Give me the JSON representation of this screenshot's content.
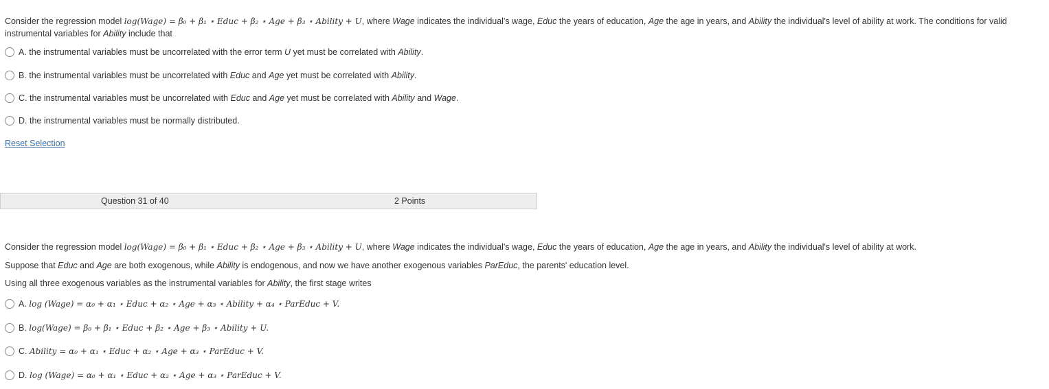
{
  "q30": {
    "stem_prefix": "Consider the regression model ",
    "model": "log(Wage) = β₀ + β₁ ⋆ Educ + β₂ ⋆ Age + β₃ ⋆ Ability + U",
    "stem_mid": ", where ",
    "var_wage": "Wage",
    "stem_wage_desc": " indicates the individual's wage, ",
    "var_educ": "Educ",
    "stem_educ_desc": " the years of education, ",
    "var_age": "Age",
    "stem_age_desc": " the age in years, and ",
    "var_ability": "Ability",
    "stem_ability_desc": " the individual's level of ability at work. The conditions for valid",
    "stem_line2_prefix": "instrumental variables for ",
    "stem_line2_var": "Ability",
    "stem_line2_suffix": " include that",
    "options": {
      "A": {
        "prefix": "A. the instrumental variables must be uncorrelated with the error term ",
        "v1": "U",
        "mid": " yet must be correlated with ",
        "v2": "Ability",
        "suffix": "."
      },
      "B": {
        "prefix": "B. the instrumental variables must be uncorrelated with ",
        "v1": "Educ",
        "and": " and ",
        "v2": "Age",
        "mid": " yet must be correlated with ",
        "v3": "Ability",
        "suffix": "."
      },
      "C": {
        "prefix": "C. the instrumental variables must be uncorrelated with ",
        "v1": "Educ",
        "and": " and ",
        "v2": "Age",
        "mid": " yet must be correlated with ",
        "v3": "Ability",
        "and2": " and ",
        "v4": "Wage",
        "suffix": "."
      },
      "D": {
        "text": "D. the instrumental variables must be normally distributed."
      }
    },
    "reset_label": "Reset Selection"
  },
  "q31_header": {
    "question_label": "Question 31 of 40",
    "points_label": "2 Points"
  },
  "q31": {
    "stem_prefix": "Consider the regression model ",
    "model": "log(Wage) = β₀ + β₁ ⋆ Educ + β₂ ⋆ Age + β₃ ⋆ Ability + U",
    "stem_mid": ", where ",
    "var_wage": "Wage",
    "stem_wage_desc": " indicates the individual's wage, ",
    "var_educ": "Educ",
    "stem_educ_desc": " the years of education, ",
    "var_age": "Age",
    "stem_age_desc": " the age in years, and ",
    "var_ability": "Ability",
    "stem_ability_desc": " the individual's level of ability at work.",
    "line2": {
      "p1": "Suppose that ",
      "v1": "Educ",
      "p2": " and ",
      "v2": "Age",
      "p3": " are both exogenous, while ",
      "v3": "Ability",
      "p4": " is endogenous, and now we have another exogenous variables ",
      "v4": "ParEduc",
      "p5": ", the parents' education level."
    },
    "line3": {
      "p1": "Using all three exogenous variables as the instrumental variables for ",
      "v1": "Ability",
      "p2": ", the first stage writes"
    },
    "options": {
      "A": {
        "label": "A. ",
        "formula": "log (Wage) = α₀ + α₁ ⋆ Educ + α₂ ⋆ Age + α₃ ⋆ Ability + α₄ ⋆ ParEduc + V."
      },
      "B": {
        "label": "B. ",
        "formula": "log(Wage) = β₀ + β₁ ⋆ Educ + β₂ ⋆ Age + β₃ ⋆ Ability + U."
      },
      "C": {
        "label": "C. ",
        "formula": "Ability = α₀ + α₁ ⋆ Educ + α₂ ⋆ Age + α₃ ⋆ ParEduc + V."
      },
      "D": {
        "label": "D. ",
        "formula": "log (Wage) = α₀ + α₁ ⋆ Educ + α₂ ⋆ Age + α₃ ⋆ ParEduc + V."
      }
    }
  }
}
